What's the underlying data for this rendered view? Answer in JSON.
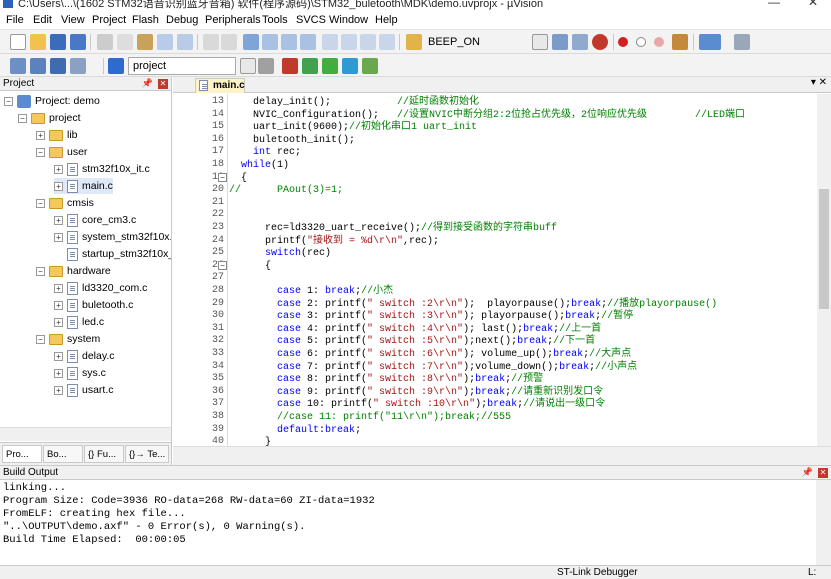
{
  "window": {
    "title": "C:\\Users\\...\\(1602 STM32语音识别蓝牙音箱) 软件(程序源码)\\STM32_buletooth\\MDK\\demo.uvprojx - µVision"
  },
  "menu": [
    "File",
    "Edit",
    "View",
    "Project",
    "Flash",
    "Debug",
    "Peripherals",
    "Tools",
    "SVCS",
    "Window",
    "Help"
  ],
  "toolbar1": {
    "find_value": "BEEP_ON"
  },
  "toolbar2": {
    "target_value": "project"
  },
  "project_pane": {
    "title": "Project",
    "root": "Project: demo",
    "items": [
      "project",
      "lib",
      "user",
      "stm32f10x_it.c",
      "main.c",
      "cmsis",
      "core_cm3.c",
      "system_stm32f10x.c",
      "startup_stm32f10x_md.s",
      "hardware",
      "ld3320_com.c",
      "buletooth.c",
      "led.c",
      "system",
      "delay.c",
      "sys.c",
      "usart.c"
    ],
    "tabs": [
      "Pro...",
      "Bo...",
      "{} Fu...",
      "{}→ Te..."
    ]
  },
  "editor": {
    "tab": "main.c",
    "line_numbers": [
      "13",
      "14",
      "15",
      "16",
      "17",
      "18",
      "19",
      "20",
      "21",
      "22",
      "23",
      "24",
      "25",
      "26",
      "27",
      "28",
      "29",
      "30",
      "31",
      "32",
      "33",
      "34",
      "35",
      "36",
      "37",
      "38",
      "39",
      "40"
    ],
    "lines": [
      "    delay_init();           //延时函数初始化",
      "    NVIC_Configuration();   //设置NVIC中断分组2:2位抢占优先级，2位响应优先级        //LED端口",
      "    uart_init(9600);//初始化串口1 uart_init",
      "    buletooth_init();",
      "    int rec;",
      "  while(1)",
      "  {",
      "//      PAout(3)=1;",
      "",
      "",
      "      rec=ld3320_uart_receive();//得到接受函数的字符串buff",
      "      printf(\"接收到 = %d\\r\\n\",rec);",
      "      switch(rec)",
      "      {",
      "",
      "        case 1: break;//小杰",
      "        case 2: printf(\" switch :2\\r\\n\");  playorpause();break;//播放playorpause()",
      "        case 3: printf(\" switch :3\\r\\n\"); playorpause();break;//暂停",
      "        case 4: printf(\" switch :4\\r\\n\"); last();break;//上一首",
      "        case 5: printf(\" switch :5\\r\\n\");next();break;//下一首",
      "        case 6: printf(\" switch :6\\r\\n\"); volume_up();break;//大声点",
      "        case 7: printf(\" switch :7\\r\\n\");volume_down();break;//小声点",
      "        case 8: printf(\" switch :8\\r\\n\");break;//预警",
      "        case 9: printf(\" switch :9\\r\\n\");break;//请重新识别发口令",
      "        case 10: printf(\" switch :10\\r\\n\");break;//请说出一级口令",
      "        //case 11: printf(\"11\\r\\n\");break;//555",
      "        default:break;",
      "      }"
    ]
  },
  "build_output": {
    "title": "Build Output",
    "lines": [
      "linking...",
      "Program Size: Code=3936 RO-data=268 RW-data=60 ZI-data=1932",
      "FromELF: creating hex file...",
      "\"..\\OUTPUT\\demo.axf\" - 0 Error(s), 0 Warning(s).",
      "Build Time Elapsed:  00:00:05"
    ]
  },
  "status": {
    "debugger": "ST-Link Debugger",
    "pos": "L:"
  }
}
